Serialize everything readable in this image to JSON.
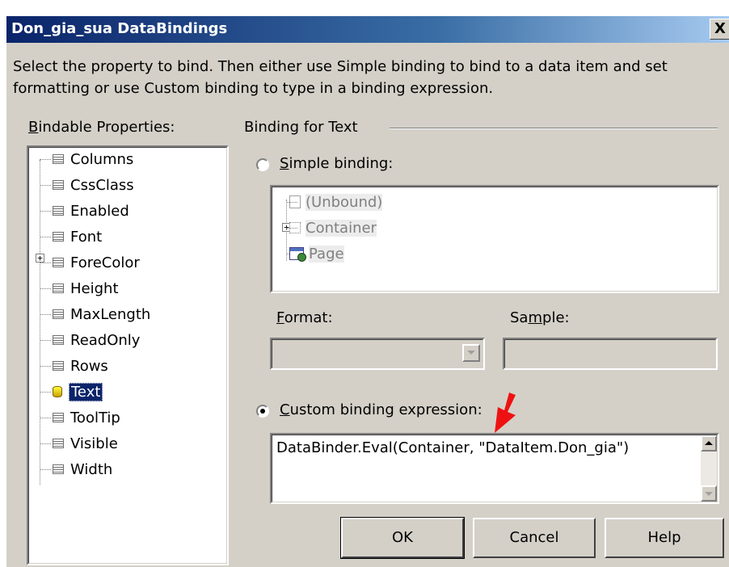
{
  "window": {
    "title": "Don_gia_sua DataBindings",
    "close_label": "X"
  },
  "description": {
    "line1": "Select the property to bind. Then either use Simple binding to bind to a data item and set",
    "line2": "formatting or use Custom binding to type in a binding expression."
  },
  "bindable": {
    "label_first": "B",
    "label_rest": "indable Properties:",
    "items": [
      {
        "label": "Columns"
      },
      {
        "label": "CssClass"
      },
      {
        "label": "Enabled"
      },
      {
        "label": "Font"
      },
      {
        "label": "ForeColor"
      },
      {
        "label": "Height"
      },
      {
        "label": "MaxLength"
      },
      {
        "label": "ReadOnly"
      },
      {
        "label": "Rows"
      },
      {
        "label": "Text"
      },
      {
        "label": "ToolTip"
      },
      {
        "label": "Visible"
      },
      {
        "label": "Width"
      }
    ]
  },
  "binding_group": {
    "label": "Binding for Text"
  },
  "simple": {
    "label_first": "S",
    "label_rest": "imple binding:",
    "tree": [
      {
        "label": "(Unbound)"
      },
      {
        "label": "Container"
      },
      {
        "label": "Page"
      }
    ]
  },
  "format": {
    "label_first": "F",
    "label_rest": "ormat:"
  },
  "sample": {
    "label_a": "Sa",
    "label_u": "m",
    "label_b": "ple:"
  },
  "custom": {
    "label_first": "C",
    "label_rest": "ustom binding expression:",
    "value": "DataBinder.Eval(Container, \"DataItem.Don_gia\")"
  },
  "buttons": {
    "ok": "OK",
    "cancel": "Cancel",
    "help": "Help"
  },
  "colors": {
    "titlebar": "#0a246a",
    "face": "#d4d0c8",
    "selection": "#0a246a",
    "arrow": "#ee1111"
  }
}
